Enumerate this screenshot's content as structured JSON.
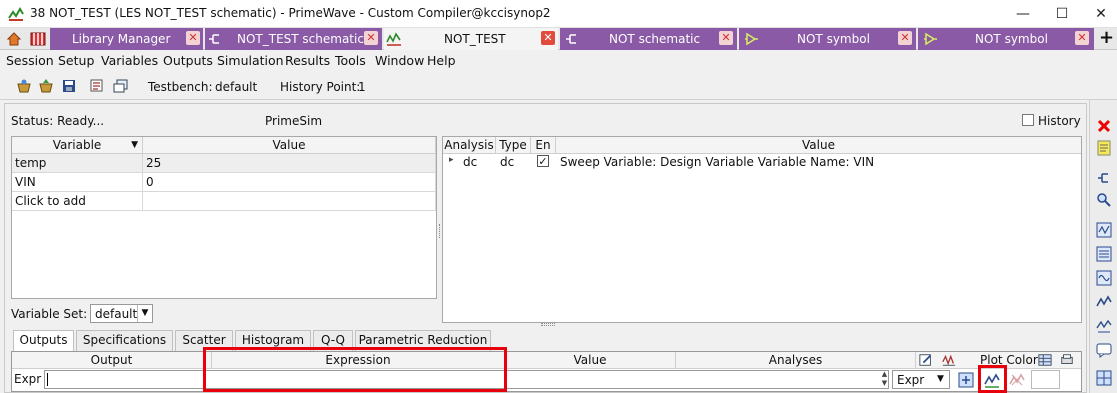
{
  "window": {
    "title": "38 NOT_TEST (LES NOT_TEST schematic) - PrimeWave - Custom Compiler@kccisynop2",
    "controls": {
      "minimize": "—",
      "maximize": "☐",
      "close": "✕"
    }
  },
  "tabs": [
    {
      "label": "Library Manager",
      "close": "✕"
    },
    {
      "label": "NOT_TEST schematic",
      "close": "✕"
    },
    {
      "label": "NOT_TEST",
      "close": "✕",
      "active": true
    },
    {
      "label": "NOT schematic",
      "close": "✕"
    },
    {
      "label": "NOT symbol",
      "close": "✕"
    },
    {
      "label": "NOT symbol",
      "close": "✕"
    }
  ],
  "tab_add": "+",
  "menu": [
    "Session",
    "Setup",
    "Variables",
    "Outputs",
    "Simulation",
    "Results",
    "Tools",
    "Window",
    "Help"
  ],
  "toolbar": {
    "testbench_label": "Testbench:",
    "testbench_value": "default",
    "history_label": "History Point:",
    "history_value": "1"
  },
  "status": {
    "text": "Status: Ready...",
    "simulator": "PrimeSim",
    "history_label": "History"
  },
  "variables_table": {
    "headers": [
      "Variable",
      "Value"
    ],
    "rows": [
      {
        "name": "temp",
        "value": "25"
      },
      {
        "name": "VIN",
        "value": "0"
      },
      {
        "name": "Click to add",
        "value": ""
      }
    ]
  },
  "analysis_table": {
    "headers": [
      "Analysis",
      "Type",
      "En",
      "Value"
    ],
    "rows": [
      {
        "analysis": "dc",
        "type": "dc",
        "enabled": "✓",
        "value": "Sweep Variable: Design Variable Variable Name: VIN"
      }
    ]
  },
  "variable_set": {
    "label": "Variable Set:",
    "value": "default"
  },
  "bottom_tabs": [
    "Outputs",
    "Specifications",
    "Scatter",
    "Histogram",
    "Q-Q",
    "Parametric Reduction"
  ],
  "outputs_table": {
    "headers": [
      "Output",
      "Expression",
      "Value",
      "Analyses",
      "Plot Color"
    ],
    "row": {
      "type": "Expr",
      "expression": "",
      "kind": "Expr"
    }
  },
  "colors": {
    "tab_purple": "#8a5aa6",
    "highlight_red": "#e8000d"
  }
}
